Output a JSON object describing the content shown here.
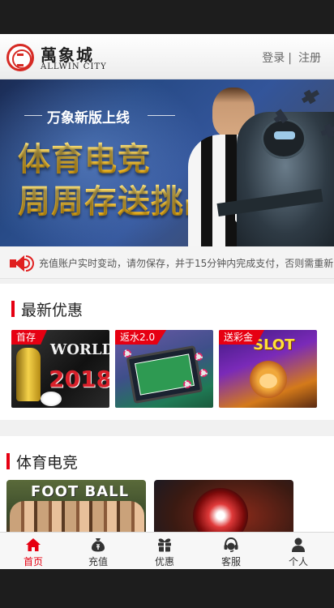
{
  "brand": {
    "name_cn": "萬象城",
    "name_en": "ALLWIN CITY"
  },
  "header": {
    "login_label": "登录",
    "separator": "|",
    "register_label": "注册"
  },
  "banner": {
    "subtitle": "万象新版上线",
    "title_line1": "体育电竞",
    "title_line2": "周周存送挑战赛"
  },
  "notice": {
    "text": "充值账户实时变动，请勿保存，并于15分钟内完成支付，否则需重新"
  },
  "promotions": {
    "title": "最新优惠",
    "items": [
      {
        "tag": "首存",
        "art_text_1": "WORLD",
        "art_text_2": "2018"
      },
      {
        "tag": "返水2.0"
      },
      {
        "tag": "送彩金",
        "art_text_1": "SLOT"
      }
    ]
  },
  "sports": {
    "title": "体育电竞",
    "items": [
      {
        "art_text": "FOOT BALL"
      },
      {
        "art_text": ""
      }
    ]
  },
  "tabbar": {
    "items": [
      {
        "label": "首页",
        "icon": "home-icon"
      },
      {
        "label": "充值",
        "icon": "money-bag-icon"
      },
      {
        "label": "优惠",
        "icon": "gift-icon"
      },
      {
        "label": "客服",
        "icon": "headset-icon"
      },
      {
        "label": "个人",
        "icon": "user-icon"
      }
    ],
    "active_index": 0
  },
  "colors": {
    "accent": "#e60012",
    "active_tab": "#e60012",
    "tab_icon": "#333333"
  }
}
